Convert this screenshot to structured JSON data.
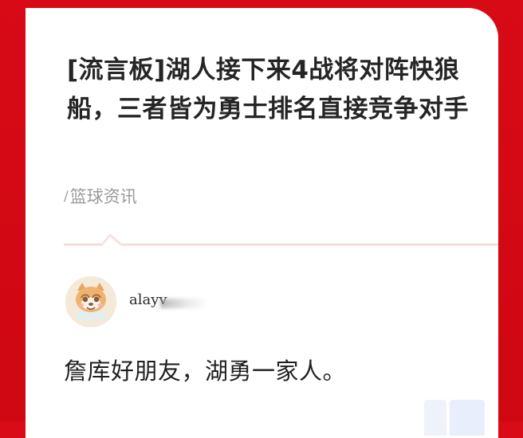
{
  "article": {
    "title": "[流言板]湖人接下来4战将对阵快狼船，三者皆为勇士排名直接竞争对手",
    "category_mark": "/",
    "category": "篮球资讯"
  },
  "comment": {
    "username": "alayv",
    "text": "詹库好朋友，湖勇一家人。"
  },
  "icons": {
    "avatar": "cartoon-fox-avatar-icon"
  },
  "colors": {
    "frame_red": "#d90b17",
    "card_white": "#ffffff",
    "title_text": "#252525",
    "muted_text": "#9a9a9a",
    "divider_pink": "#f3c7c9"
  }
}
